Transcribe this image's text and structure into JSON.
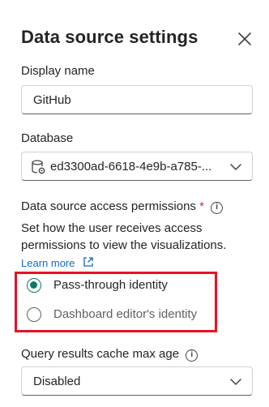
{
  "panel": {
    "title": "Data source settings"
  },
  "display_name": {
    "label": "Display name",
    "value": "GitHub"
  },
  "database": {
    "label": "Database",
    "selected": "ed3300ad-6618-4e9b-a785-..."
  },
  "access": {
    "label": "Data source access permissions",
    "required_mark": "*",
    "info_glyph": "i",
    "description": "Set how the user receives access permissions to view the visualizations.",
    "learn_more": "Learn more",
    "options": [
      {
        "label": "Pass-through identity",
        "checked": true
      },
      {
        "label": "Dashboard editor's identity",
        "checked": false
      }
    ]
  },
  "cache": {
    "label": "Query results cache max age",
    "info_glyph": "i",
    "selected": "Disabled"
  },
  "colors": {
    "accent": "#117865",
    "link": "#0f6cbd",
    "highlight": "#e81123",
    "required": "#c4314b"
  },
  "icons": {
    "close": "close-icon",
    "database": "database-icon",
    "chevron": "chevron-down-icon",
    "external": "external-link-icon",
    "info": "info-icon"
  }
}
